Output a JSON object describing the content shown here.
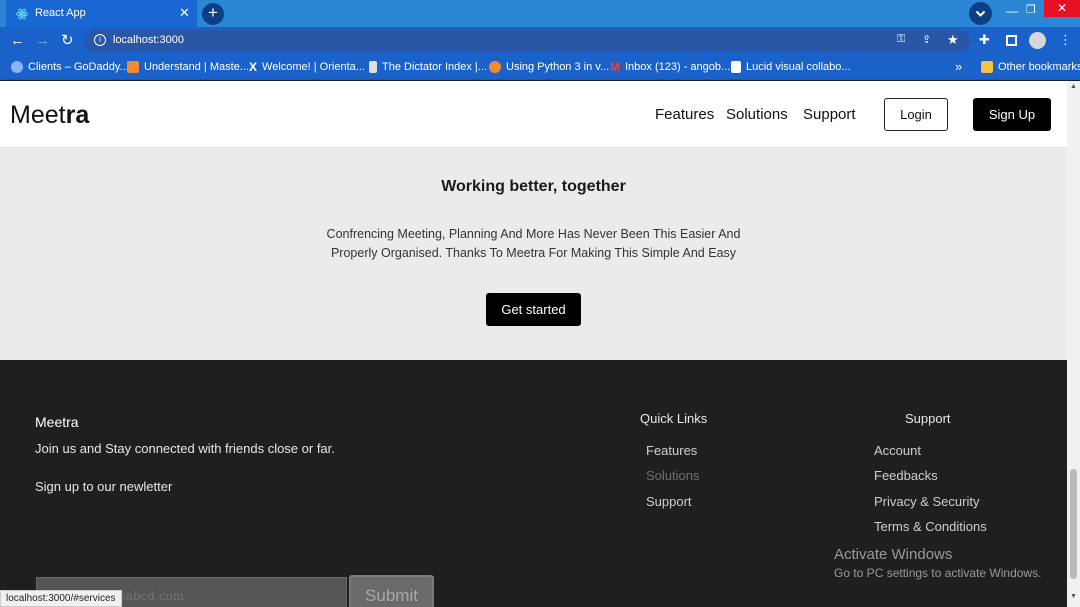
{
  "browser": {
    "tab_title": "React App",
    "url": "localhost:3000",
    "status_url": "localhost:3000/#services",
    "bookmarks": [
      {
        "label": "Clients – GoDaddy...",
        "icon": "godaddy-icon",
        "color": "#8ab4f8"
      },
      {
        "label": "Understand | Maste...",
        "icon": "c-icon",
        "color": "#f28b30"
      },
      {
        "label": "Welcome! | Orienta...",
        "icon": "x-icon",
        "color": "#ffffff"
      },
      {
        "label": "The Dictator Index |...",
        "icon": "dictator-icon",
        "color": "#e0e0e0"
      },
      {
        "label": "Using Python 3 in v...",
        "icon": "python-icon",
        "color": "#f28b30"
      },
      {
        "label": "Inbox (123) - angob...",
        "icon": "gmail-icon",
        "color": "#ea4335"
      },
      {
        "label": "Lucid visual collabo...",
        "icon": "lucid-icon",
        "color": "#ffffff"
      }
    ],
    "other_bookmarks": "Other bookmarks",
    "overflow": "»"
  },
  "nav": {
    "logo_light": "Meet",
    "logo_bold": "ra",
    "links": [
      "Features",
      "Solutions",
      "Support"
    ],
    "login": "Login",
    "signup": "Sign Up"
  },
  "hero": {
    "title": "Working better, together",
    "line1": "Confrencing Meeting, Planning And More Has Never Been This Easier And",
    "line2": "Properly Organised. Thanks To Meetra For Making This Simple And Easy",
    "cta": "Get started"
  },
  "footer": {
    "brand": "Meetra",
    "tagline": "Join us and Stay connected with friends close or far.",
    "newsletter_label": "Sign up to our newletter",
    "email_placeholder": "youremail@abcd.com",
    "submit": "Submit",
    "quick_links": {
      "title": "Quick Links",
      "items": [
        "Features",
        "Solutions",
        "Support"
      ]
    },
    "support": {
      "title": "Support",
      "items": [
        "Account",
        "Feedbacks",
        "Privacy & Security",
        "Terms & Conditions"
      ]
    }
  },
  "watermark": {
    "title": "Activate Windows",
    "subtitle": "Go to PC settings to activate Windows."
  },
  "colors": {
    "tab_bg": "#2b86d6",
    "toolbar_bg": "#1a62c9",
    "hero_bg": "#ebebeb",
    "footer_bg": "#1f1f1f"
  }
}
